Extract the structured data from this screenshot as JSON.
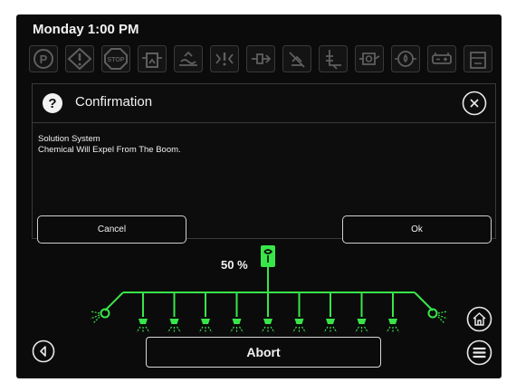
{
  "header": {
    "clock": "Monday 1:00 PM"
  },
  "status_icons": [
    "parking-brake-icon",
    "warning-icon",
    "stop-icon",
    "tank-icon",
    "agitation-icon",
    "pressure-icon",
    "flow-icon",
    "nozzle-icon",
    "boom-level-icon",
    "oil-icon",
    "engine-oil-icon",
    "battery-icon",
    "fuel-icon"
  ],
  "dialog": {
    "title": "Confirmation",
    "line1": "Solution System",
    "line2": "Chemical Will Expel From The Boom.",
    "cancel_label": "Cancel",
    "ok_label": "Ok"
  },
  "boom": {
    "rate_text": "50 %",
    "active_color": "#39e64a",
    "nozzle_count": 9
  },
  "footer": {
    "abort_label": "Abort"
  }
}
